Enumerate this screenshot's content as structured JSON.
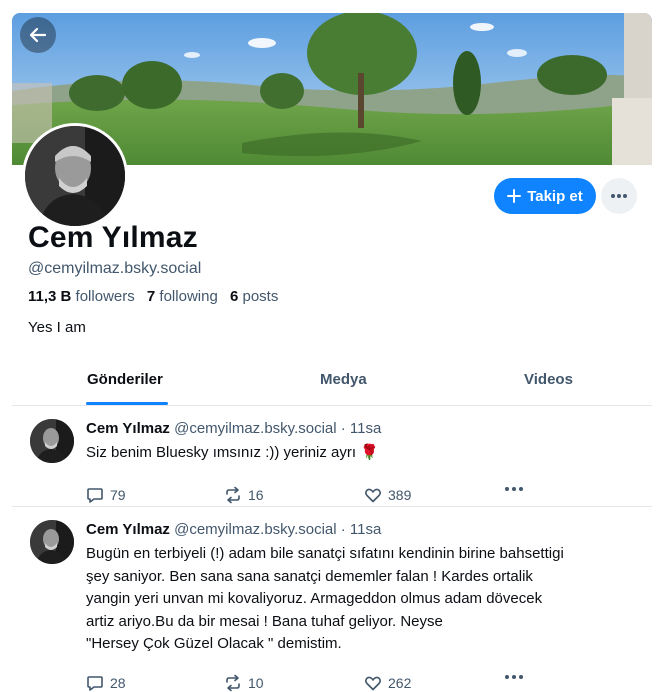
{
  "profile": {
    "name": "Cem Yılmaz",
    "handle": "@cemyilmaz.bsky.social",
    "followers_count": "11,3 B",
    "followers_label": "followers",
    "following_count": "7",
    "following_label": "following",
    "posts_count": "6",
    "posts_label": "posts",
    "bio": "Yes I am",
    "follow_label": "Takip et"
  },
  "tabs": [
    {
      "label": "Gönderiler"
    },
    {
      "label": "Medya"
    },
    {
      "label": "Videos"
    }
  ],
  "posts": [
    {
      "author": "Cem Yılmaz",
      "handle": "@cemyilmaz.bsky.social",
      "time": "· 11sa",
      "text": "Siz benim Bluesky ımsınız :)) yeriniz ayrı 🌹",
      "replies": "79",
      "reposts": "16",
      "likes": "389"
    },
    {
      "author": "Cem Yılmaz",
      "handle": "@cemyilmaz.bsky.social",
      "time": "· 11sa",
      "text_lines": [
        "Bugün en terbiyeli (!) adam bile sanatçi sıfatını kendinin birine bahsettigi",
        "şey saniyor. Ben sana sana sanatçi dememler falan ! Kardes ortalik",
        "yangin yeri unvan mi kovaliyoruz. Armageddon olmus adam dövecek",
        "artiz ariyo.Bu da bir mesai ! Bana tuhaf geliyor. Neyse",
        "\"Hersey Çok Güzel Olacak \" demistim."
      ],
      "replies": "28",
      "reposts": "10",
      "likes": "262"
    }
  ],
  "icons": {
    "back": "arrow-left-icon",
    "more": "ellipsis-icon",
    "plus": "plus-icon",
    "reply": "comment-icon",
    "repost": "repost-icon",
    "like": "heart-icon"
  },
  "colors": {
    "accent": "#1083fe",
    "muted_text": "#42576c",
    "divider": "#e3e7eb"
  }
}
